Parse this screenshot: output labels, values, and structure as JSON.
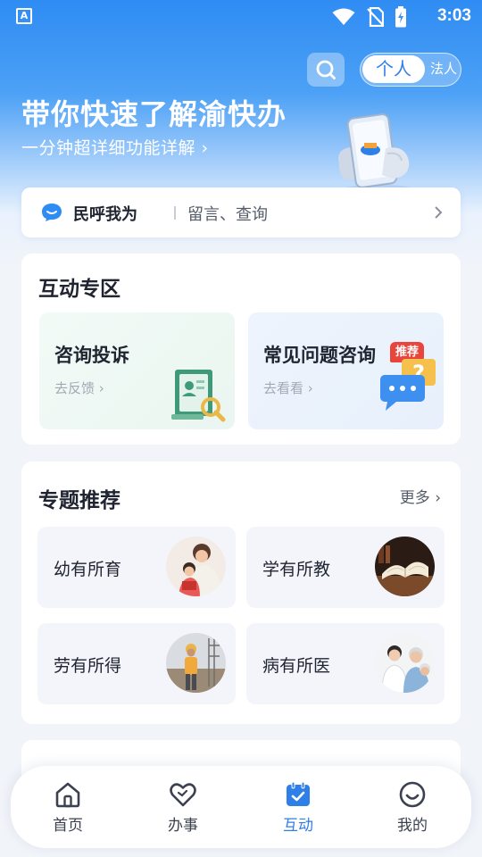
{
  "status_bar": {
    "notification_icon": "A",
    "time": "3:03",
    "icons": [
      "wifi-icon",
      "no-sim-icon",
      "battery-charging-icon"
    ]
  },
  "header": {
    "mode_switch": {
      "active": "个人",
      "inactive": "法人"
    },
    "title": "带你快速了解渝快办",
    "subtitle": "一分钟超详细功能详解 ›"
  },
  "minhu": {
    "title": "民呼我为",
    "text": "留言、查询"
  },
  "interact": {
    "title": "互动专区",
    "tiles": [
      {
        "title": "咨询投诉",
        "sub": "去反馈 ›"
      },
      {
        "title": "常见问题咨询",
        "sub": "去看看 ›",
        "tag": "推荐"
      }
    ]
  },
  "topics": {
    "title": "专题推荐",
    "more": "更多 ›",
    "items": [
      {
        "label": "幼有所育"
      },
      {
        "label": "学有所教"
      },
      {
        "label": "劳有所得"
      },
      {
        "label": "病有所医"
      }
    ]
  },
  "nav": {
    "items": [
      {
        "label": "首页",
        "icon": "home-icon"
      },
      {
        "label": "办事",
        "icon": "heart-icon"
      },
      {
        "label": "互动",
        "icon": "calendar-icon"
      },
      {
        "label": "我的",
        "icon": "smile-icon"
      }
    ],
    "active_index": 2
  },
  "colors": {
    "accent": "#2f7fe8",
    "tag_red": "#e8453c",
    "hero_blue": "#2f8cf3"
  }
}
